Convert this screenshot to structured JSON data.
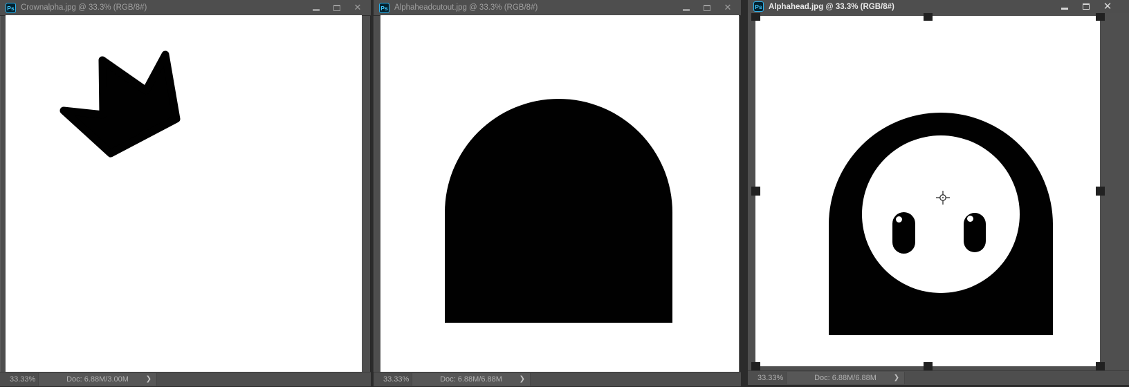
{
  "app": {
    "file_icon_label": "Ps",
    "accent_color": "#2bb3ef",
    "chrome_color": "#4e4e4e",
    "canvas_color": "#ffffff",
    "artwork_color": "#010101"
  },
  "window_controls": {
    "close_glyph": "✕"
  },
  "status": {
    "chevron_glyph": "❯"
  },
  "windows": [
    {
      "title": "Crownalpha.jpg @ 33.3% (RGB/8#)",
      "zoom_level": "33.33%",
      "doc_info": "Doc: 6.88M/3.00M",
      "active": false,
      "artwork": "black tilted crown silhouette on white canvas"
    },
    {
      "title": "Alphaheadcutout.jpg @ 33.3% (RGB/8#)",
      "zoom_level": "33.33%",
      "doc_info": "Doc: 6.88M/6.88M",
      "active": false,
      "artwork": "black dome (head cutout) silhouette on white canvas"
    },
    {
      "title": "Alphahead.jpg @ 33.3% (RGB/8#)",
      "zoom_level": "33.33%",
      "doc_info": "Doc: 6.88M/6.88M",
      "active": true,
      "artwork": "black dome head with white face circle and two black capsule eyes with white glints; free-transform handles around canvas and center reference crosshair"
    }
  ]
}
